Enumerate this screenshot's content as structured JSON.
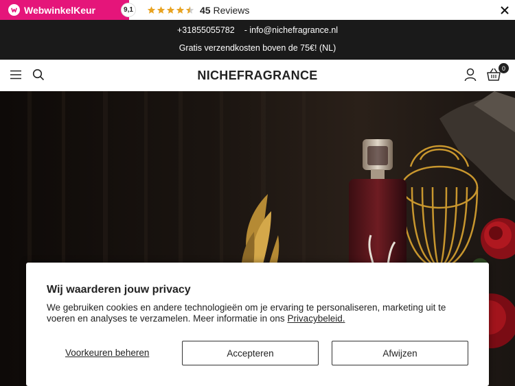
{
  "review_bar": {
    "brand": "WebwinkelKeur",
    "score": "9,1",
    "rating_stars": 4.5,
    "reviews_count": "45",
    "reviews_label": "Reviews"
  },
  "contact": {
    "phone": "+31855055782",
    "email": "- info@nichefragrance.nl",
    "shipping_notice": "Gratis verzendkosten boven de 75€! (NL)"
  },
  "header": {
    "logo": "NICHEFRAGRANCE",
    "cart_count": "0"
  },
  "cookie": {
    "title": "Wij waarderen jouw privacy",
    "text": "We gebruiken cookies en andere technologieën om je ervaring te personaliseren, marketing uit te voeren en analyses te verzamelen. Meer informatie in ons ",
    "link": "Privacybeleid.",
    "prefs_label": "Voorkeuren beheren",
    "accept_label": "Accepteren",
    "reject_label": "Afwijzen"
  },
  "colors": {
    "brand_pink": "#e5157a",
    "star_gold": "#e8a321",
    "dark_bar": "#1a1a1a"
  }
}
